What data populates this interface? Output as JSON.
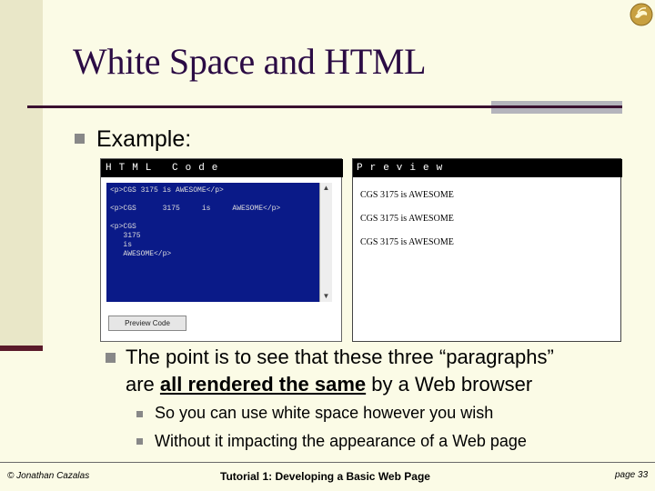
{
  "slide": {
    "title": "White Space and HTML",
    "bullet_main": "Example:",
    "point_line1": "The point is to see that these three “paragraphs”",
    "point_line2_a": "are ",
    "point_line2_emph": "all rendered the same",
    "point_line2_b": " by a Web browser",
    "sub_points": [
      "So you can use white space however you wish",
      "Without it impacting the appearance of a Web page"
    ]
  },
  "screenshot": {
    "code_header": "HTML Code",
    "code_lines": [
      "<p>CGS 3175 is AWESOME</p>",
      "",
      "<p>CGS      3175     is     AWESOME</p>",
      "",
      "<p>CGS",
      "   3175",
      "   is",
      "   AWESOME</p>"
    ],
    "preview_button": "Preview Code",
    "preview_header": "Preview",
    "preview_lines": [
      "CGS 3175 is AWESOME",
      "CGS 3175 is AWESOME",
      "CGS 3175 is AWESOME"
    ]
  },
  "footer": {
    "left": "© Jonathan Cazalas",
    "center": "Tutorial 1:  Developing a Basic Web Page",
    "right": "page 33"
  },
  "colors": {
    "background": "#fbfbe6",
    "title": "#2b0b44",
    "code_bg": "#0a1a88"
  },
  "icons": {
    "logo": "pegasus-logo-icon"
  }
}
